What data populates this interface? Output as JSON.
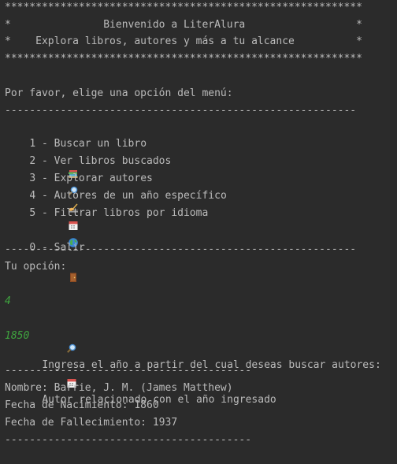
{
  "banner": {
    "stars": "**********************************************************",
    "line1": "*               Bienvenido a LiterAlura                  *",
    "line2": "*    Explora libros, autores y más a tu alcance          *"
  },
  "prompt": "Por favor, elige una opción del menú:",
  "separator_long": "------------------------------------------------------------",
  "menu": [
    {
      "label": "1 - Buscar un libro",
      "icon": "books-icon"
    },
    {
      "label": "2 - Ver libros buscados",
      "icon": "magnifier-icon"
    },
    {
      "label": "3 - Explorar autores",
      "icon": "writing-hand-icon"
    },
    {
      "label": "4 - Autores de un año específico",
      "icon": "calendar-icon"
    },
    {
      "label": "5 - Filtrar libros por idioma",
      "icon": "globe-icon"
    }
  ],
  "exit": {
    "label": "0 - Salir",
    "icon": "door-icon"
  },
  "your_option": "Tu opción:",
  "user_choice": "4",
  "year_prompt": "Ingresa el año a partir del cual deseas buscar autores:",
  "year_input": "1850",
  "result_header": "Autor relacionado con el año ingresado",
  "separator_short": "----------------------------------------",
  "author": {
    "name": "Nombre: Barrie, J. M. (James Matthew)",
    "birth": "Fecha de Nacimiento: 1860",
    "death": "Fecha de Fallecimiento: 1937"
  },
  "colors": {
    "background": "#2b2b2b",
    "text": "#bbbbbb",
    "input": "#3fa43f"
  }
}
